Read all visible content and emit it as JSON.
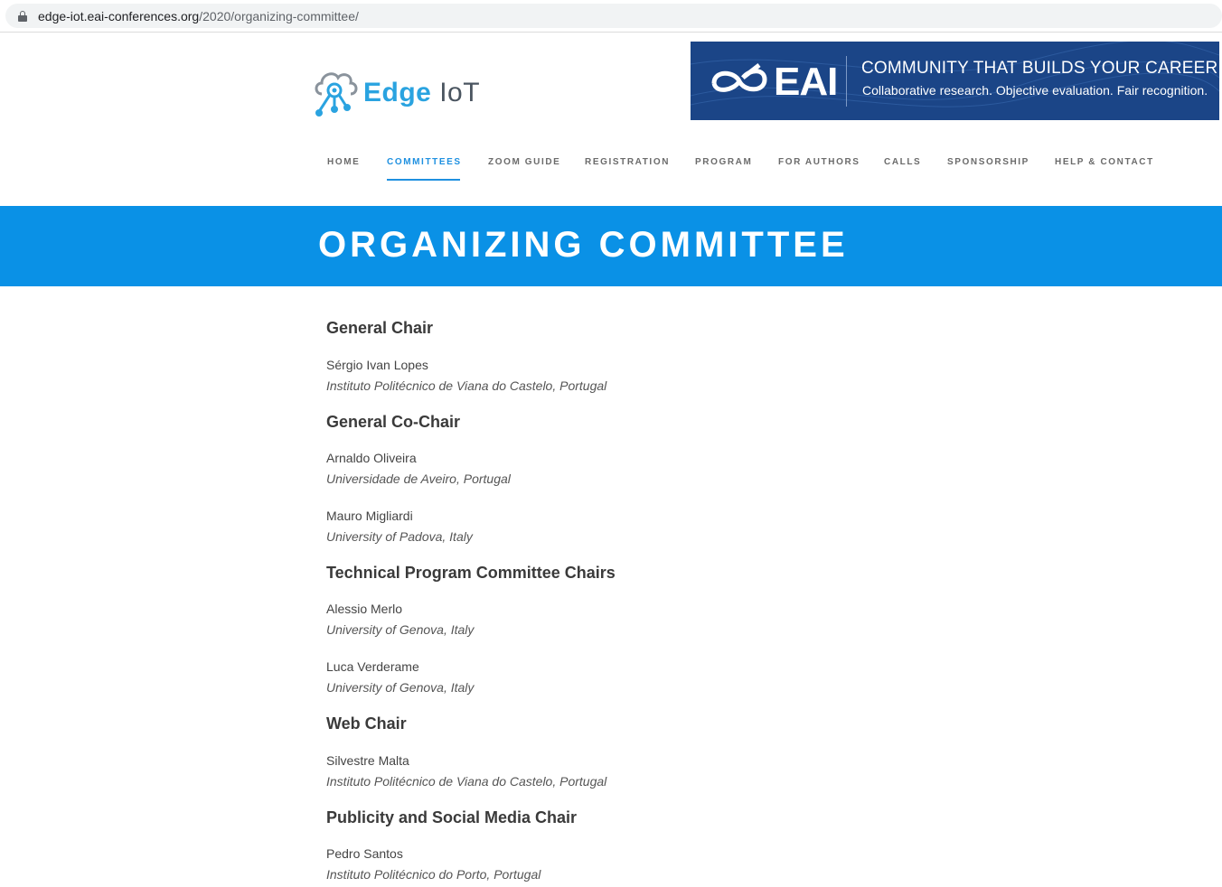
{
  "browser": {
    "url_host": "edge-iot.eai-conferences.org",
    "url_path": "/2020/organizing-committee/"
  },
  "header": {
    "logo": {
      "word1": "Edge",
      "word2": "IoT"
    },
    "banner": {
      "brand": "EAI",
      "tagline": "COMMUNITY THAT BUILDS YOUR CAREER",
      "subline": "Collaborative research.  Objective evaluation.  Fair recognition."
    }
  },
  "nav": {
    "items": [
      {
        "label": "HOME"
      },
      {
        "label": "COMMITTEES"
      },
      {
        "label": "ZOOM GUIDE"
      },
      {
        "label": "REGISTRATION"
      },
      {
        "label": "PROGRAM"
      },
      {
        "label": "FOR AUTHORS"
      },
      {
        "label": "CALLS"
      },
      {
        "label": "SPONSORSHIP"
      },
      {
        "label": "HELP & CONTACT"
      }
    ],
    "active": "COMMITTEES"
  },
  "page": {
    "title": "ORGANIZING COMMITTEE"
  },
  "sections": [
    {
      "heading": "General Chair",
      "people": [
        {
          "name": "Sérgio Ivan Lopes",
          "affiliation": "Instituto Politécnico de Viana do Castelo, Portugal"
        }
      ]
    },
    {
      "heading": "General Co-Chair",
      "people": [
        {
          "name": "Arnaldo Oliveira",
          "affiliation": "Universidade de Aveiro, Portugal"
        },
        {
          "name": "Mauro Migliardi",
          "affiliation": "University of Padova, Italy"
        }
      ]
    },
    {
      "heading": "Technical Program Committee Chairs",
      "people": [
        {
          "name": "Alessio Merlo",
          "affiliation": "University of Genova, Italy"
        },
        {
          "name": "Luca Verderame",
          "affiliation": "University of Genova, Italy"
        }
      ]
    },
    {
      "heading": "Web Chair",
      "people": [
        {
          "name": "Silvestre Malta",
          "affiliation": "Instituto Politécnico de Viana do Castelo, Portugal"
        }
      ]
    },
    {
      "heading": "Publicity and Social Media Chair",
      "people": [
        {
          "name": "Pedro Santos",
          "affiliation": "Instituto Politécnico do Porto, Portugal"
        }
      ]
    }
  ]
}
